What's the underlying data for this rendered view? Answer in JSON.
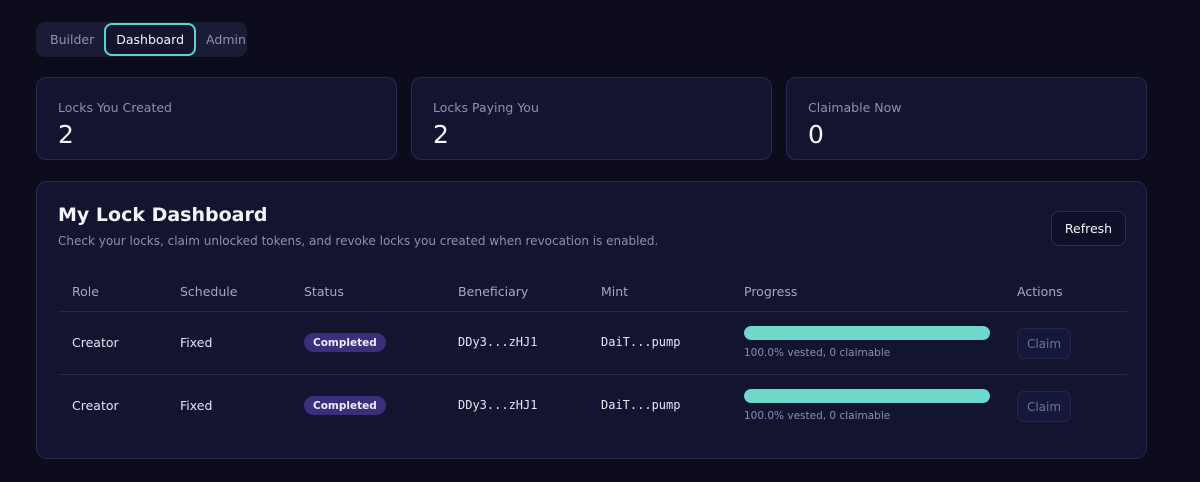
{
  "tabs": [
    {
      "label": "Builder",
      "active": false
    },
    {
      "label": "Dashboard",
      "active": true
    },
    {
      "label": "Admin",
      "active": false
    }
  ],
  "stats": [
    {
      "label": "Locks You Created",
      "value": "2"
    },
    {
      "label": "Locks Paying You",
      "value": "2"
    },
    {
      "label": "Claimable Now",
      "value": "0"
    }
  ],
  "panel": {
    "title": "My Lock Dashboard",
    "subtitle": "Check your locks, claim unlocked tokens, and revoke locks you created when revocation is enabled.",
    "refresh_label": "Refresh"
  },
  "table": {
    "headers": {
      "role": "Role",
      "schedule": "Schedule",
      "status": "Status",
      "beneficiary": "Beneficiary",
      "mint": "Mint",
      "progress": "Progress",
      "actions": "Actions"
    },
    "rows": [
      {
        "role": "Creator",
        "schedule": "Fixed",
        "status": "Completed",
        "beneficiary": "DDy3...zHJ1",
        "mint": "DaiT...pump",
        "progress_percent": 100,
        "progress_text": "100.0% vested, 0 claimable",
        "action_label": "Claim"
      },
      {
        "role": "Creator",
        "schedule": "Fixed",
        "status": "Completed",
        "beneficiary": "DDy3...zHJ1",
        "mint": "DaiT...pump",
        "progress_percent": 100,
        "progress_text": "100.0% vested, 0 claimable",
        "action_label": "Claim"
      }
    ]
  },
  "colors": {
    "background": "#0c0c1c",
    "card": "#121430",
    "accent": "#6fd8cb",
    "badge": "#3a2f7a"
  }
}
